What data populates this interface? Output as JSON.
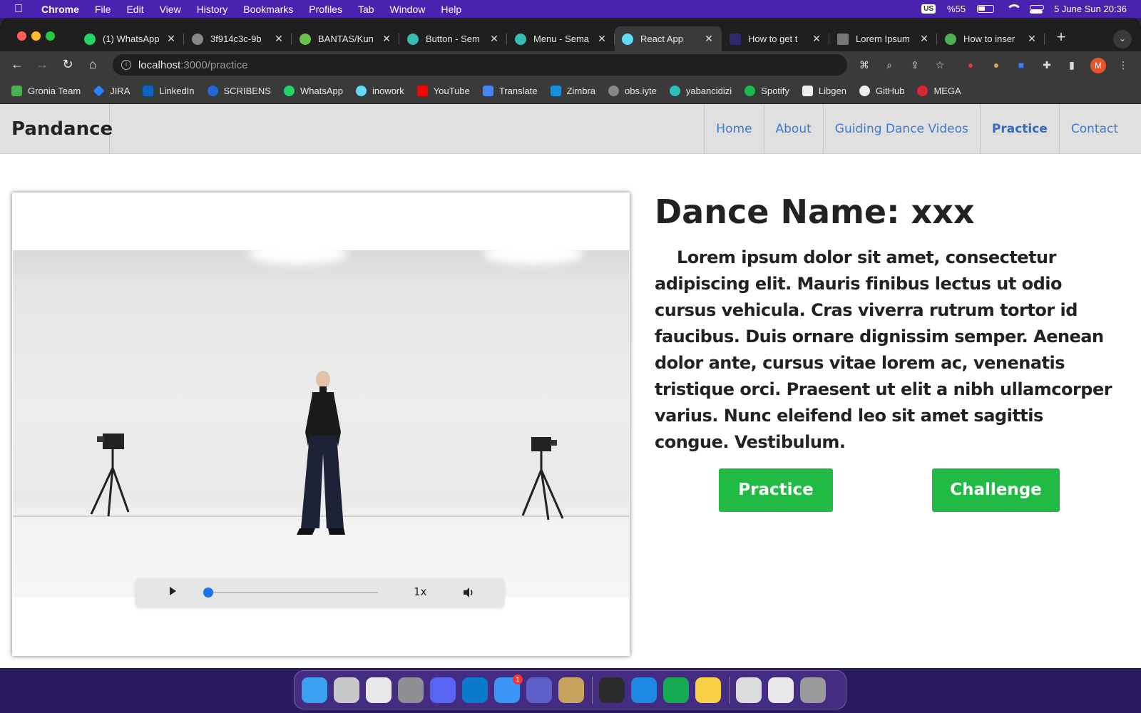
{
  "menubar": {
    "apple_icon": "apple-icon",
    "app_name": "Chrome",
    "items": [
      "File",
      "Edit",
      "View",
      "History",
      "Bookmarks",
      "Profiles",
      "Tab",
      "Window",
      "Help"
    ],
    "keyboard": "US",
    "battery": "%55",
    "datetime": "5 June Sun  20:36"
  },
  "tabs": [
    {
      "label": "(1) WhatsApp",
      "icon": "whatsapp-icon",
      "color": "#25d366"
    },
    {
      "label": "3f914c3c-9b",
      "icon": "globe-icon",
      "color": "#888888"
    },
    {
      "label": "BANTAS/Kun",
      "icon": "gitlab-icon",
      "color": "#6cc24a"
    },
    {
      "label": "Button - Sem",
      "icon": "semantic-ui-icon",
      "color": "#35bdb2"
    },
    {
      "label": "Menu - Sema",
      "icon": "semantic-ui-icon",
      "color": "#35bdb2"
    },
    {
      "label": "React App",
      "icon": "react-icon",
      "color": "#61dafb",
      "active": true
    },
    {
      "label": "How to get t",
      "icon": "ss-icon",
      "color": "#2d2a6e"
    },
    {
      "label": "Lorem Ipsum",
      "icon": "lorem-icon",
      "color": "#777777"
    },
    {
      "label": "How to inser",
      "icon": "mongodb-icon",
      "color": "#4caf50"
    }
  ],
  "address": {
    "host": "localhost",
    "path": ":3000/practice"
  },
  "bookmarks": [
    {
      "label": "Gronia Team",
      "icon": "gronia-icon",
      "color": "#4caf50"
    },
    {
      "label": "JIRA",
      "icon": "jira-icon",
      "color": "#2684ff"
    },
    {
      "label": "LinkedIn",
      "icon": "linkedin-icon",
      "color": "#0a66c2"
    },
    {
      "label": "SCRIBENS",
      "icon": "scribens-icon",
      "color": "#1e6bd6"
    },
    {
      "label": "WhatsApp",
      "icon": "whatsapp-icon",
      "color": "#25d366"
    },
    {
      "label": "inowork",
      "icon": "react-icon",
      "color": "#61dafb"
    },
    {
      "label": "YouTube",
      "icon": "youtube-icon",
      "color": "#ff0000"
    },
    {
      "label": "Translate",
      "icon": "translate-icon",
      "color": "#4285f4"
    },
    {
      "label": "Zimbra",
      "icon": "zimbra-icon",
      "color": "#1a8cd8"
    },
    {
      "label": "obs.iyte",
      "icon": "globe-icon",
      "color": "#888888"
    },
    {
      "label": "yabancidizi",
      "icon": "yabancidizi-icon",
      "color": "#2ac1bc"
    },
    {
      "label": "Spotify",
      "icon": "spotify-icon",
      "color": "#1db954"
    },
    {
      "label": "Libgen",
      "icon": "libgen-icon",
      "color": "#ffffff"
    },
    {
      "label": "GitHub",
      "icon": "github-icon",
      "color": "#ffffff"
    },
    {
      "label": "MEGA",
      "icon": "mega-icon",
      "color": "#d9272e"
    }
  ],
  "profile_initial": "M",
  "site": {
    "brand": "Pandance",
    "nav": [
      {
        "label": "Home",
        "active": false
      },
      {
        "label": "About",
        "active": false
      },
      {
        "label": "Guiding Dance Videos",
        "active": false
      },
      {
        "label": "Practice",
        "active": true
      },
      {
        "label": "Contact",
        "active": false
      }
    ],
    "accent_link": "#3a7bd5"
  },
  "player": {
    "progress_fraction": 0.0,
    "speed": "1x",
    "play_icon": "play-icon",
    "volume_icon": "volume-icon"
  },
  "dance": {
    "title": "Dance Name: xxx",
    "description": "Lorem ipsum dolor sit amet, consectetur adipiscing elit. Mauris finibus lectus ut odio cursus vehicula. Cras viverra rutrum tortor id faucibus. Duis ornare dignissim semper. Aenean dolor ante, cursus vitae lorem ac, venenatis tristique orci. Praesent ut elit a nibh ullamcorper varius. Nunc eleifend leo sit amet sagittis congue. Vestibulum.",
    "practice_label": "Practice",
    "challenge_label": "Challenge",
    "button_color": "#21ba45"
  },
  "dock": {
    "apps": [
      {
        "name": "finder-icon",
        "color": "#3aa0f0"
      },
      {
        "name": "launchpad-icon",
        "color": "#c8c8c8"
      },
      {
        "name": "chrome-icon",
        "color": "#e8e8e8"
      },
      {
        "name": "system-preferences-icon",
        "color": "#8e8e93"
      },
      {
        "name": "discord-icon",
        "color": "#5865f2"
      },
      {
        "name": "vscode-icon",
        "color": "#0a7acc"
      },
      {
        "name": "mail-icon",
        "color": "#3a95f5",
        "badge": "1"
      },
      {
        "name": "teams-icon",
        "color": "#5b5fc7"
      },
      {
        "name": "archive-utility-icon",
        "color": "#c9a45c"
      },
      {
        "name": "terminal-icon",
        "color": "#2b2b2b"
      },
      {
        "name": "webstorm-icon",
        "color": "#1e88e5"
      },
      {
        "name": "mongodb-compass-icon",
        "color": "#13aa52"
      },
      {
        "name": "notes-icon",
        "color": "#f7d046"
      },
      {
        "name": "document-icon",
        "color": "#dcdcdc"
      },
      {
        "name": "preview-icon",
        "color": "#e8e8e8"
      },
      {
        "name": "trash-icon",
        "color": "#9a9a9a"
      }
    ]
  }
}
